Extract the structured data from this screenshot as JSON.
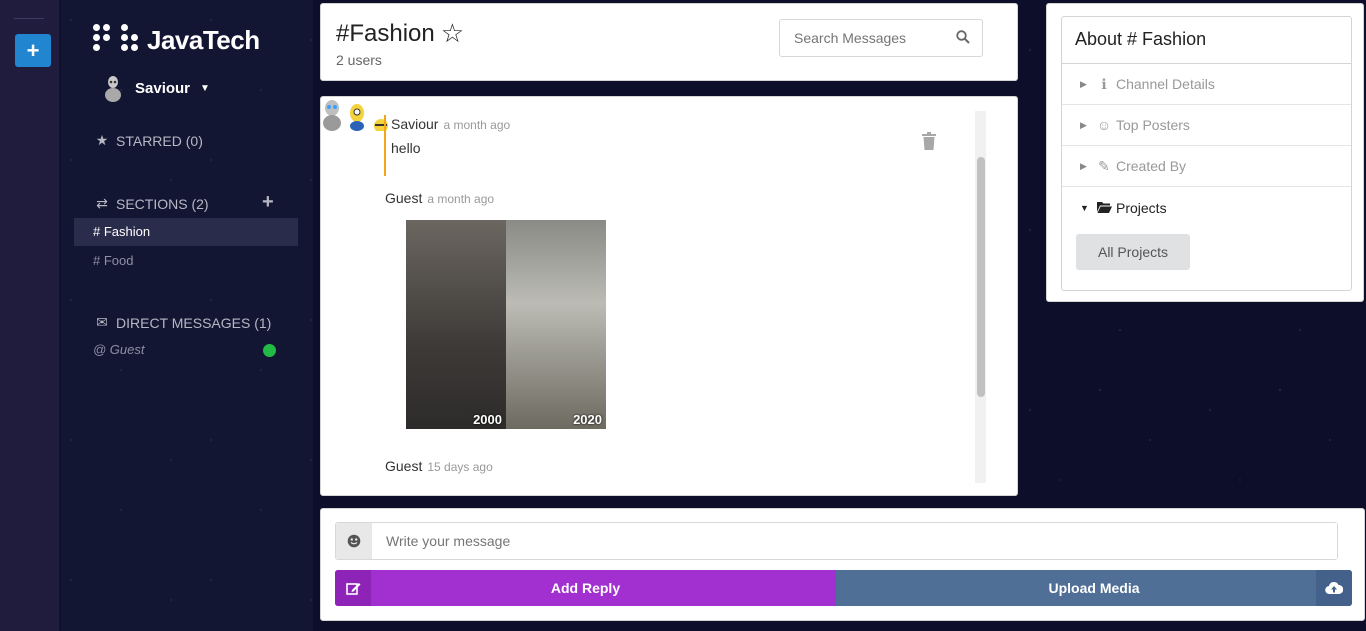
{
  "app": {
    "name": "JavaTech"
  },
  "user": {
    "name": "Saviour"
  },
  "sidebar": {
    "starred_label": "STARRED (0)",
    "sections_label": "SECTIONS (2)",
    "channels": [
      {
        "label": "# Fashion",
        "active": true
      },
      {
        "label": "# Food",
        "active": false
      }
    ],
    "direct_messages_label": "DIRECT MESSAGES (1)",
    "dms": [
      {
        "label": "@ Guest",
        "status": "online"
      }
    ]
  },
  "header": {
    "channel_title": "#Fashion",
    "users_count": "2 users",
    "search_placeholder": "Search Messages"
  },
  "messages": [
    {
      "author": "Saviour",
      "time": "a month ago",
      "text": "hello",
      "own": true
    },
    {
      "author": "Guest",
      "time": "a month ago",
      "image_labels": [
        "2000",
        "2020"
      ]
    },
    {
      "author": "Guest",
      "time": "15 days ago"
    }
  ],
  "about": {
    "title": "About # Fashion",
    "items": [
      {
        "label": "Channel Details",
        "icon": "info-icon"
      },
      {
        "label": "Top Posters",
        "icon": "user-circle-icon"
      },
      {
        "label": "Created By",
        "icon": "pencil-icon"
      },
      {
        "label": "Projects",
        "icon": "folder-open-icon",
        "open": true
      }
    ],
    "all_projects_button": "All Projects"
  },
  "compose": {
    "placeholder": "Write your message",
    "reply_label": "Add Reply",
    "upload_label": "Upload Media"
  },
  "colors": {
    "accent_blue": "#2185d0",
    "reply_purple": "#a22fcf",
    "upload_steel": "#4f6f96",
    "own_message_bar": "#f2a619",
    "online": "#21ba45"
  }
}
